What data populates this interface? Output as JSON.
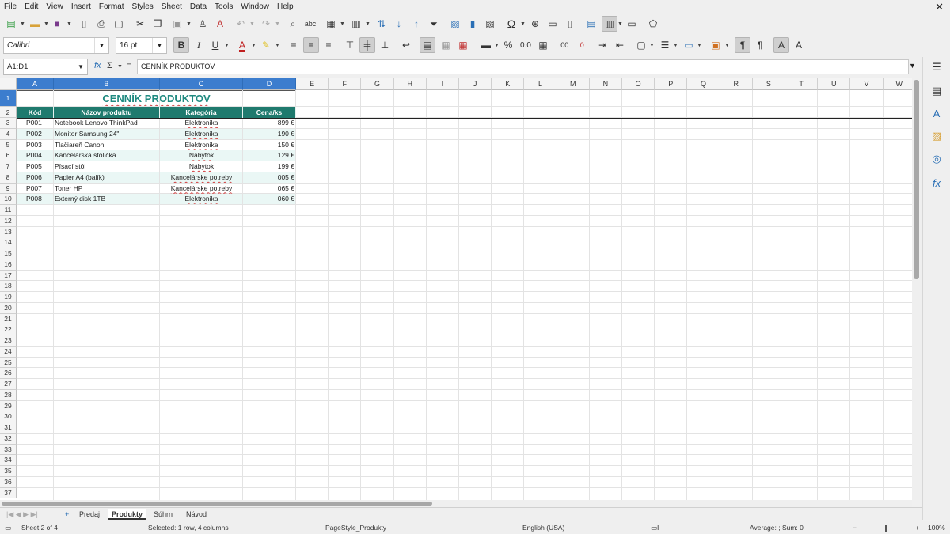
{
  "menu": [
    "File",
    "Edit",
    "View",
    "Insert",
    "Format",
    "Styles",
    "Sheet",
    "Data",
    "Tools",
    "Window",
    "Help"
  ],
  "font": {
    "name": "Calibri",
    "size": "16 pt"
  },
  "namebox": "A1:D1",
  "formula": "CENNÍK PRODUKTOV",
  "columns": [
    "A",
    "B",
    "C",
    "D",
    "E",
    "F",
    "G",
    "H",
    "I",
    "J",
    "K",
    "L",
    "M",
    "N",
    "O",
    "P",
    "Q",
    "R",
    "S",
    "T",
    "U",
    "V",
    "W"
  ],
  "rows_count": 37,
  "table": {
    "title": "CENNÍK PRODUKTOV",
    "headers": [
      "Kód",
      "Názov produktu",
      "Kategória",
      "Cena/ks"
    ],
    "rows": [
      [
        "P001",
        "Notebook Lenovo ThinkPad",
        "Elektronika",
        "899 €"
      ],
      [
        "P002",
        "Monitor Samsung 24\"",
        "Elektronika",
        "190 €"
      ],
      [
        "P003",
        "Tlačiareň Canon",
        "Elektronika",
        "150 €"
      ],
      [
        "P004",
        "Kancelárska stolička",
        "Nábytok",
        "129 €"
      ],
      [
        "P005",
        "Písací stôl",
        "Nábytok",
        "199 €"
      ],
      [
        "P006",
        "Papier A4 (balík)",
        "Kancelárske potreby",
        "005 €"
      ],
      [
        "P007",
        "Toner HP",
        "Kancelárske potreby",
        "065 €"
      ],
      [
        "P008",
        "Externý disk 1TB",
        "Elektronika",
        "060 €"
      ]
    ]
  },
  "tabs": [
    "Predaj",
    "Produkty",
    "Súhrn",
    "Návod"
  ],
  "active_tab": "Produkty",
  "status": {
    "sheet": "Sheet 2 of 4",
    "selection": "Selected: 1 row, 4 columns",
    "pagestyle": "PageStyle_Produkty",
    "language": "English (USA)",
    "sum": "Average: ; Sum: 0",
    "zoom": "100%"
  },
  "colors": {
    "header_bg": "#1f7a6e",
    "title_text": "#1f8a80",
    "band": "#eaf7f5",
    "selection": "#3c7dce"
  }
}
